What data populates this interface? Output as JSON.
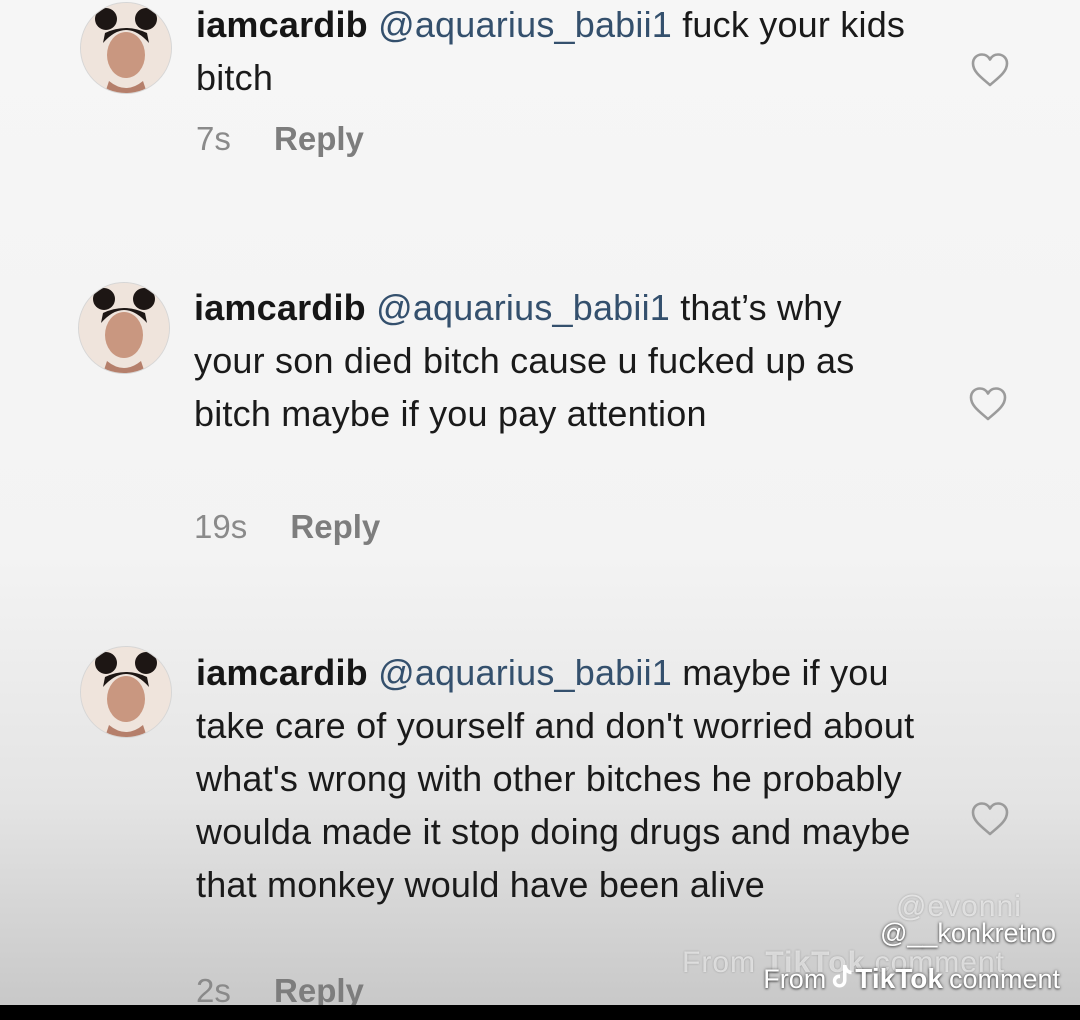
{
  "comments": [
    {
      "username": "iamcardib",
      "mention": "@aquarius_babii1",
      "text": " fuck your kids bitch",
      "time": "7s",
      "reply_label": "Reply"
    },
    {
      "username": "iamcardib",
      "mention": "@aquarius_babii1",
      "text": " that’s why your son died bitch cause u fucked up as bitch maybe if you pay attention",
      "time": "19s",
      "reply_label": "Reply"
    },
    {
      "username": "iamcardib",
      "mention": "@aquarius_babii1",
      "text": " maybe if you take care of yourself and don't worried about what's wrong with other bitches he probably woulda made it stop doing drugs and maybe that monkey would have been alive",
      "time": "2s",
      "reply_label": "Reply"
    }
  ],
  "watermark": {
    "handle": "@__konkretno",
    "from_label": "From",
    "brand": "TikTok",
    "suffix": "comment",
    "ghost_handle": "@evonni",
    "ghost_from": "From",
    "ghost_brand": "TikTok",
    "ghost_suffix": "comment"
  },
  "colors": {
    "mention": "#34506d",
    "meta": "#8a8a8a",
    "heart": "#9b9b9b"
  }
}
